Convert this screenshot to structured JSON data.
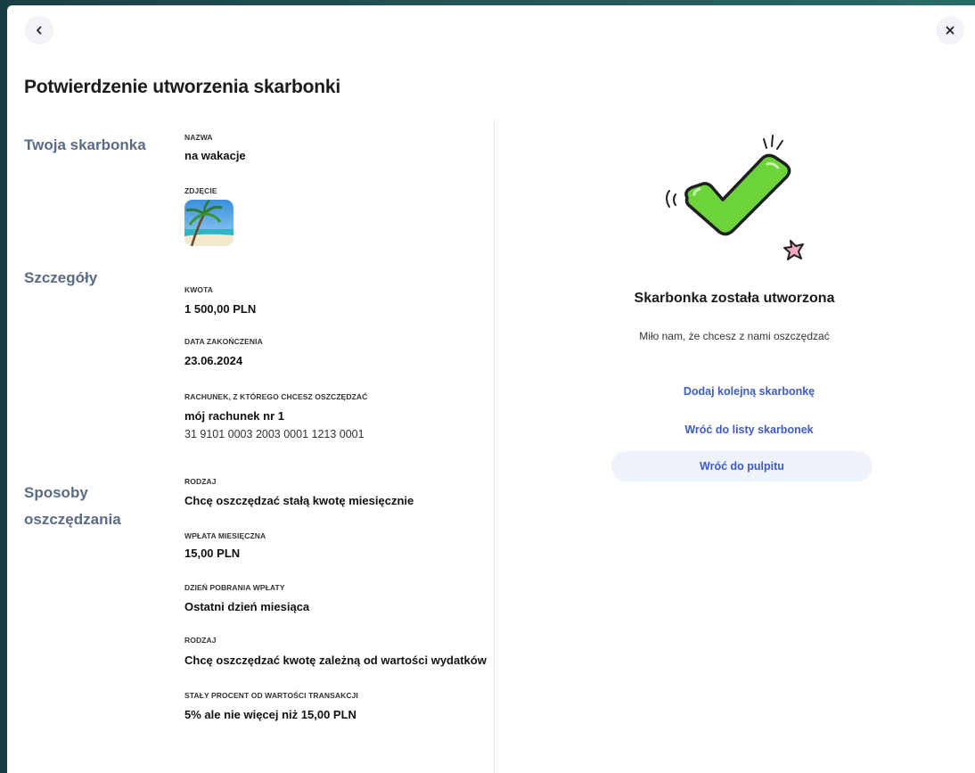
{
  "page_title": "Potwierdzenie utworzenia skarbonki",
  "sections": {
    "piggy": {
      "title": "Twoja skarbonka",
      "name_label": "NAZWA",
      "name_value": "na wakacje",
      "photo_label": "ZDJĘCIE"
    },
    "details": {
      "title": "Szczegóły",
      "amount_label": "KWOTA",
      "amount_value": "1 500,00 PLN",
      "end_date_label": "DATA ZAKOŃCZENIA",
      "end_date_value": "23.06.2024",
      "account_label": "RACHUNEK, Z KTÓREGO CHCESZ OSZCZĘDZAĆ",
      "account_name": "mój rachunek nr 1",
      "account_number": "31 9101 0003 2003 0001 1213 0001"
    },
    "methods": {
      "title_line1": "Sposoby",
      "title_line2": "oszczędzania",
      "type1_label": "RODZAJ",
      "type1_value": "Chcę oszczędzać stałą kwotę miesięcznie",
      "monthly_label": "WPŁATA MIESIĘCZNA",
      "monthly_value": "15,00 PLN",
      "collection_day_label": "DZIEŃ POBRANIA WPŁATY",
      "collection_day_value": "Ostatni dzień miesiąca",
      "type2_label": "RODZAJ",
      "type2_value": "Chcę oszczędzać kwotę zależną od wartości wydatków",
      "percent_label": "STAŁY PROCENT OD WARTOŚCI TRANSAKCJI",
      "percent_value": "5% ale nie więcej niż 15,00 PLN"
    }
  },
  "success": {
    "title": "Skarbonka została utworzona",
    "subtitle": "Miło nam, że chcesz z nami oszczędzać",
    "add_another": "Dodaj kolejną skarbonkę",
    "back_to_list": "Wróć do listy skarbonek",
    "back_to_dashboard": "Wróć do pulpitu"
  },
  "icons": {
    "back": "chevron-left-icon",
    "close": "close-icon",
    "success": "checkmark-icon",
    "photo": "palm-beach-photo"
  },
  "colors": {
    "accent": "#3d5bc7",
    "section_title": "#5a6b85",
    "check_green": "#6cd43a",
    "button_bg": "#eef2fb"
  }
}
